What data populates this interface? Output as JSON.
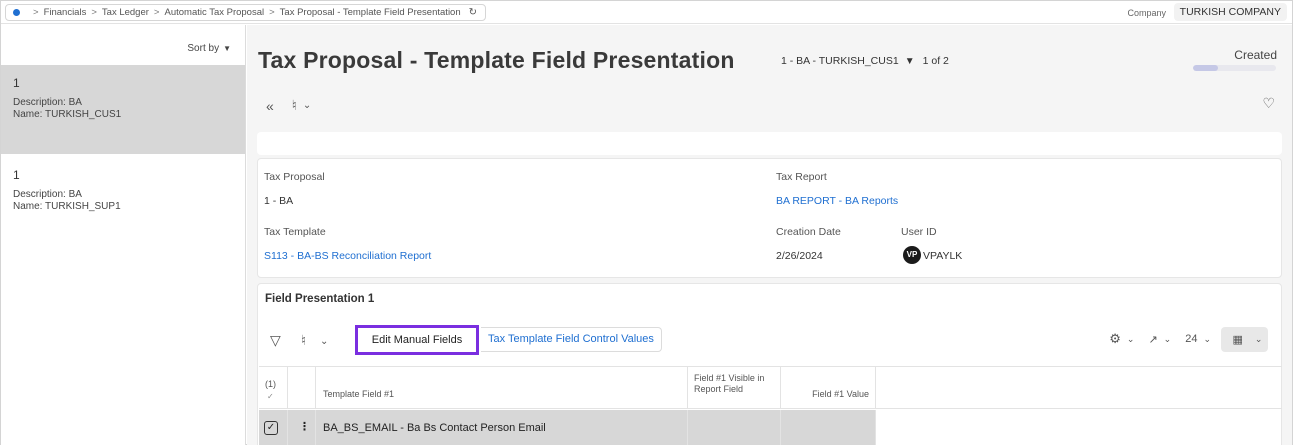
{
  "breadcrumb": {
    "items": [
      "Financials",
      "Tax Ledger",
      "Automatic Tax Proposal",
      "Tax Proposal - Template Field Presentation"
    ],
    "separator": ">"
  },
  "company": {
    "label": "Company",
    "value": "TURKISH COMPANY"
  },
  "sidebar": {
    "sort_label": "Sort by",
    "items": [
      {
        "number": "1",
        "description": "Description:  BA",
        "name": "Name:  TURKISH_CUS1",
        "selected": true
      },
      {
        "number": "1",
        "description": "Description:  BA",
        "name": "Name:  TURKISH_SUP1",
        "selected": false
      }
    ]
  },
  "header": {
    "title": "Tax Proposal - Template Field Presentation",
    "record_selector": "1 - BA - TURKISH_CUS1",
    "record_position": "1 of 2",
    "status": "Created",
    "status_progress": 0.3
  },
  "form": {
    "tax_proposal_label": "Tax Proposal",
    "tax_proposal_value": "1 - BA",
    "tax_report_label": "Tax Report",
    "tax_report_value": "BA REPORT - BA Reports",
    "tax_template_label": "Tax Template",
    "tax_template_value": "S113 - BA-BS Reconciliation Report",
    "creation_date_label": "Creation Date",
    "creation_date_value": "2/26/2024",
    "user_id_label": "User ID",
    "user_id_initials": "VP",
    "user_id_value": "VPAYLK"
  },
  "grid": {
    "title": "Field Presentation 1",
    "edit_button": "Edit Manual Fields",
    "control_values_button": "Tax Template Field Control Values",
    "page_size": "24",
    "selected_count": "(1)",
    "columns": [
      "Template Field #1",
      "Field #1 Visible in Report Field",
      "Field #1 Value"
    ],
    "rows": [
      {
        "template_field": "BA_BS_EMAIL - Ba Bs Contact Person Email",
        "visible": "",
        "value": ""
      }
    ]
  },
  "colors": {
    "accent": "#1f6fd1",
    "highlight": "#7a2ee0",
    "selected_row": "#d7d7d7"
  }
}
